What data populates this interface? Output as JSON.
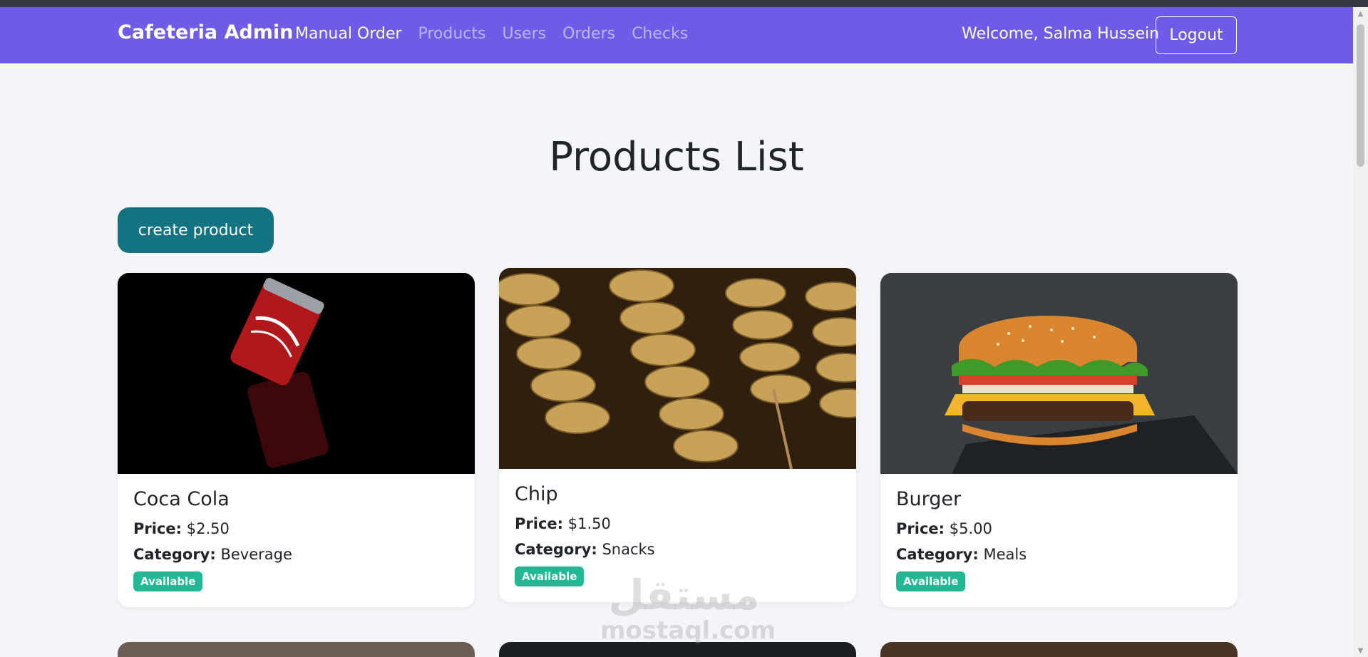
{
  "navbar": {
    "brand": "Cafeteria Admin",
    "links": [
      "Manual Order",
      "Products",
      "Users",
      "Orders",
      "Checks"
    ],
    "welcome": "Welcome, Salma Hussein",
    "logout": "Logout"
  },
  "page": {
    "title": "Products List",
    "create_button": "create product"
  },
  "products": [
    {
      "name": "Coca Cola",
      "price_label": "Price:",
      "price": "$2.50",
      "category_label": "Category:",
      "category": "Beverage",
      "status": "Available",
      "image": "coca-cola-can"
    },
    {
      "name": "Chip",
      "price_label": "Price:",
      "price": "$1.50",
      "category_label": "Category:",
      "category": "Snacks",
      "status": "Available",
      "image": "potato-chips"
    },
    {
      "name": "Burger",
      "price_label": "Price:",
      "price": "$5.00",
      "category_label": "Category:",
      "category": "Meals",
      "status": "Available",
      "image": "burger"
    }
  ],
  "watermark": {
    "logo": "مستقل",
    "text": "mostaql.com"
  },
  "colors": {
    "navbar": "#6c5ce7",
    "create_button": "#147380",
    "badge": "#20b993",
    "background": "#f4f5f9"
  }
}
